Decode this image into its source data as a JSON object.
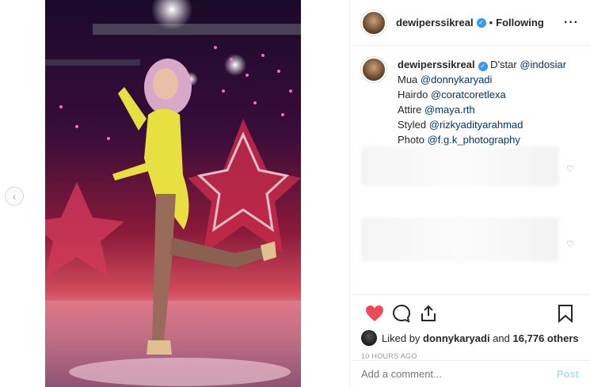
{
  "post": {
    "username": "dewiperssikreal",
    "following_label": "Following",
    "separator": "•",
    "more_label": "···"
  },
  "caption": {
    "username": "dewiperssikreal",
    "lines": [
      {
        "prefix": " D'star ",
        "mention": "@indosiar"
      },
      {
        "prefix": "Mua ",
        "mention": "@donnykaryadi"
      },
      {
        "prefix": "Hairdo ",
        "mention": "@coratcoretlexa"
      },
      {
        "prefix": "Attire ",
        "mention": "@maya.rth"
      },
      {
        "prefix": "Styled ",
        "mention": "@rizkyadityarahmad"
      },
      {
        "prefix": "Photo ",
        "mention": "@f.g.k_photography"
      }
    ]
  },
  "likes": {
    "liked_by": "Liked by",
    "user": "donnykaryadi",
    "and": "and",
    "count": "16,776 others"
  },
  "timestamp": "10 HOURS AGO",
  "comment": {
    "placeholder": "Add a comment...",
    "post_label": "Post"
  },
  "colors": {
    "like_red": "#ed4956",
    "link_blue": "#003569",
    "verified_blue": "#3897f0",
    "post_disabled": "#b2dffc"
  },
  "icons": {
    "prev": "chevron-left-icon",
    "like": "heart-icon",
    "comment": "comment-icon",
    "share": "share-icon",
    "save": "bookmark-icon",
    "more": "more-options-icon"
  }
}
